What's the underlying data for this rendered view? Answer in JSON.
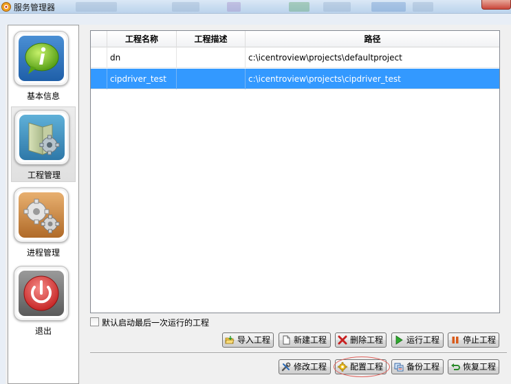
{
  "window": {
    "title": "服务管理器",
    "accent": "#3399ff"
  },
  "nav": {
    "items": [
      {
        "label": "基本信息",
        "icon": "info-icon",
        "selected": false
      },
      {
        "label": "工程管理",
        "icon": "folder-gear-icon",
        "selected": true
      },
      {
        "label": "进程管理",
        "icon": "gears-icon",
        "selected": false
      },
      {
        "label": "退出",
        "icon": "power-icon",
        "selected": false
      }
    ]
  },
  "table": {
    "columns": [
      "工程名称",
      "工程描述",
      "路径"
    ],
    "rows": [
      {
        "name": "dn",
        "desc": "",
        "path": "c:\\icentroview\\projects\\defaultproject",
        "selected": false
      },
      {
        "name": "cipdriver_test",
        "desc": "",
        "path": "c:\\icentroview\\projects\\cipdriver_test",
        "selected": true
      }
    ]
  },
  "options": {
    "autostart_label": "默认启动最后一次运行的工程",
    "autostart_checked": false
  },
  "buttons": {
    "import": "导入工程",
    "new": "新建工程",
    "delete": "删除工程",
    "run": "运行工程",
    "stop": "停止工程",
    "modify": "修改工程",
    "configure": "配置工程",
    "backup": "备份工程",
    "restore": "恢复工程"
  }
}
